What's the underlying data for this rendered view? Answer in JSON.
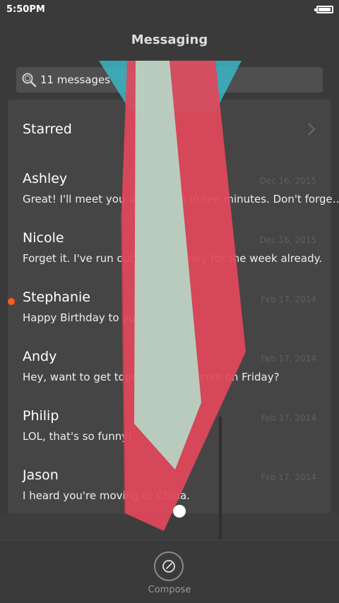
{
  "status_bar": {
    "time": "5:50PM",
    "battery_level": 0.95
  },
  "header": {
    "title": "Messaging"
  },
  "search": {
    "text": "11 messages",
    "icon": "search-icon"
  },
  "starred": {
    "label": "Starred",
    "icon": "chevron-right-icon"
  },
  "messages": [
    {
      "name": "Ashley",
      "preview": "Great! I'll meet you downstairs in ten minutes. Don't forge…",
      "date": "Dec 16, 2015",
      "unread": false
    },
    {
      "name": "Nicole",
      "preview": "Forget it. I've run out of my money for the week already.",
      "date": "Dec 16, 2015",
      "unread": false
    },
    {
      "name": "Stephanie",
      "preview": "Happy Birthday to you!",
      "date": "Feb 17, 2014",
      "unread": true
    },
    {
      "name": "Andy",
      "preview": "Hey, want to get together with Nicole on Friday?",
      "date": "Feb 17, 2014",
      "unread": false
    },
    {
      "name": "Philip",
      "preview": "LOL, that's so funny!",
      "date": "Feb 17, 2014",
      "unread": false
    },
    {
      "name": "Jason",
      "preview": "I heard you're moving to China.",
      "date": "Feb 17, 2014",
      "unread": false
    }
  ],
  "compose": {
    "label": "Compose",
    "icon": "compose-icon"
  },
  "colors": {
    "unread_dot": "#ff5a1f",
    "tie_red": "#e0475a",
    "tie_mint": "#b7d3c3",
    "tie_cyan": "#3ab7c4"
  }
}
